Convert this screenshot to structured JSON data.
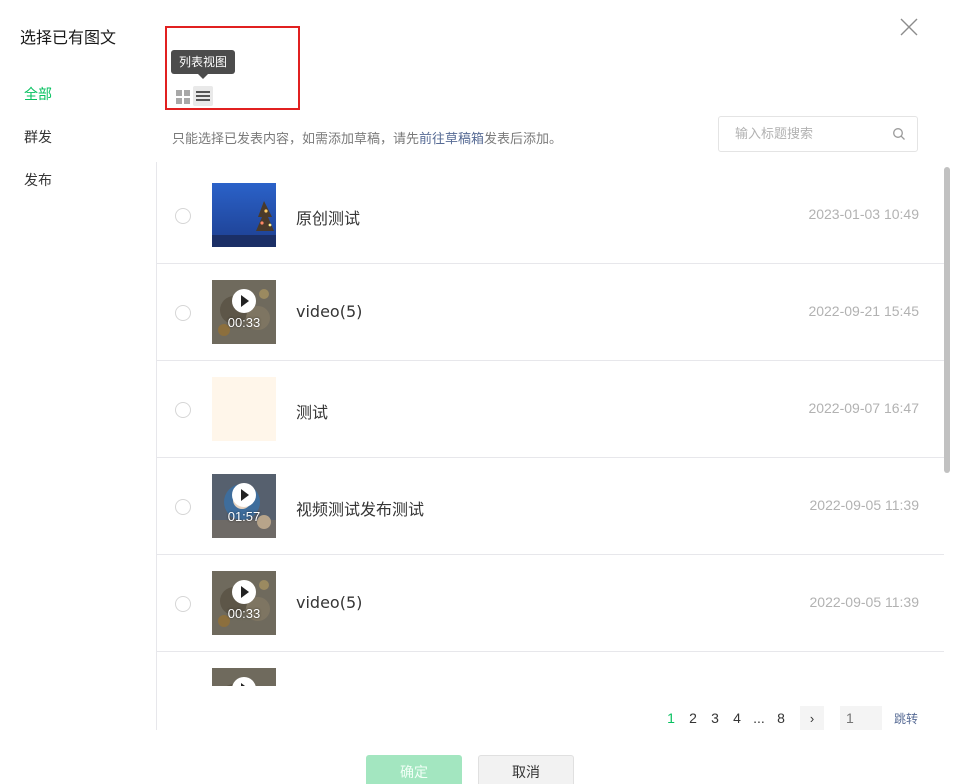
{
  "dialog": {
    "title": "选择已有图文",
    "tip_prefix": "只能选择已发表内容，如需添加草稿，请先",
    "tip_link": "前往草稿箱",
    "tip_suffix": "发表后添加。",
    "search_placeholder": "输入标题搜索",
    "tooltip": "列表视图"
  },
  "sidebar": {
    "items": [
      {
        "label": "全部",
        "active": true
      },
      {
        "label": "群发",
        "active": false
      },
      {
        "label": "发布",
        "active": false
      }
    ]
  },
  "items": [
    {
      "title": "原创测试",
      "date": "2023-01-03 10:49",
      "video": false,
      "duration": ""
    },
    {
      "title": "video(5)",
      "date": "2022-09-21 15:45",
      "video": true,
      "duration": "00:33"
    },
    {
      "title": "测试",
      "date": "2022-09-07 16:47",
      "video": false,
      "duration": ""
    },
    {
      "title": "视频测试发布测试",
      "date": "2022-09-05 11:39",
      "video": true,
      "duration": "01:57"
    },
    {
      "title": "video(5)",
      "date": "2022-09-05 11:39",
      "video": true,
      "duration": "00:33"
    }
  ],
  "pagination": {
    "pages": [
      "1",
      "2",
      "3",
      "4",
      "...",
      "8"
    ],
    "current": "1",
    "next": "›",
    "input_value": "1",
    "jump_label": "跳转"
  },
  "footer": {
    "ok_label": "确定",
    "cancel_label": "取消"
  },
  "colors": {
    "accent": "#07c160",
    "link": "#576b95",
    "highlight_box": "#e12020"
  },
  "icons": [
    "close-icon",
    "grid-view-icon",
    "list-view-icon",
    "search-icon",
    "play-icon"
  ]
}
